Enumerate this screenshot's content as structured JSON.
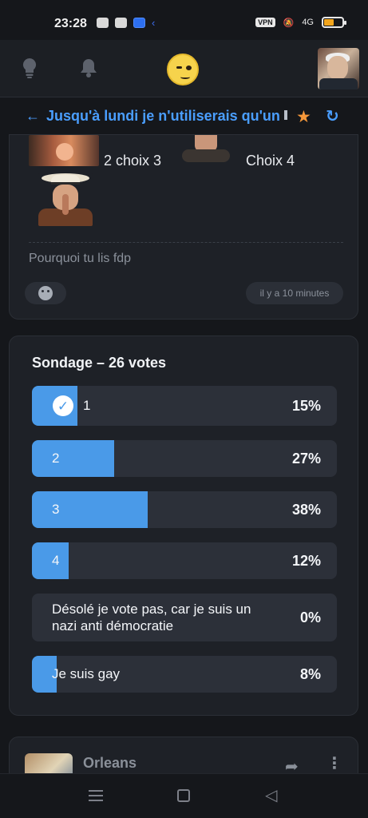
{
  "status": {
    "time": "23:28",
    "vpn": "VPN",
    "network": "4G"
  },
  "nav": {
    "icons": [
      "lightbulb-icon",
      "bell-icon",
      "smirk-emoji-icon",
      "profile-avatar"
    ]
  },
  "topic": {
    "title": "Jusqu'à lundi je n'utiliserais qu'un",
    "back_icon": "arrow-left-icon",
    "star_icon": "star-icon",
    "refresh_icon": "refresh-icon",
    "star_color": "#f5973a",
    "accent_color": "#4a9eff"
  },
  "post": {
    "choice_text_a": "2 choix 3",
    "choice_text_b": "Choix 4",
    "caption": "Pourquoi tu lis fdp",
    "time_ago": "il y a 10 minutes"
  },
  "poll": {
    "title": "Sondage – 26 votes",
    "fill_color": "#4a9ae8",
    "options": [
      {
        "label": "1",
        "percent_text": "15%",
        "percent": 15,
        "selected": true
      },
      {
        "label": "2",
        "percent_text": "27%",
        "percent": 27,
        "selected": false
      },
      {
        "label": "3",
        "percent_text": "38%",
        "percent": 38,
        "selected": false
      },
      {
        "label": "4",
        "percent_text": "12%",
        "percent": 12,
        "selected": false
      },
      {
        "label": "Désolé je vote pas, car je suis un nazi anti démocratie",
        "percent_text": "0%",
        "percent": 0,
        "selected": false
      },
      {
        "label": "Je suis gay",
        "percent_text": "8%",
        "percent": 8,
        "selected": false
      }
    ]
  },
  "next_post": {
    "name": "Orleans",
    "icons": [
      "share-icon",
      "more-vertical-icon"
    ]
  }
}
